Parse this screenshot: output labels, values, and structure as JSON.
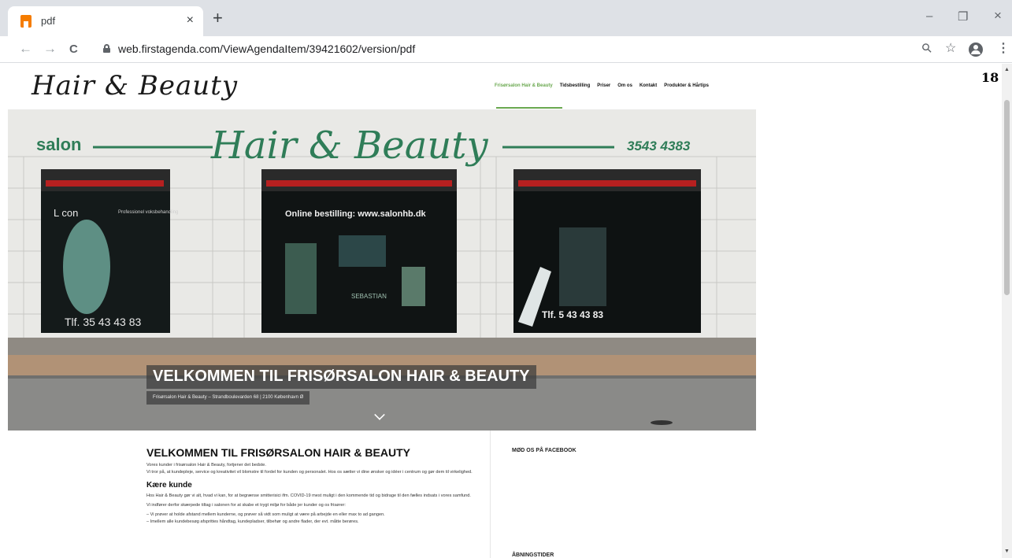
{
  "browser": {
    "tab_title": "pdf",
    "tab_close": "×",
    "new_tab": "+",
    "url": "web.firstagenda.com/ViewAgendaItem/39421602/version/pdf",
    "window_controls": {
      "minimize": "–",
      "restore": "❐",
      "close": "×"
    },
    "nav": {
      "back": "←",
      "forward": "→",
      "reload": "C"
    },
    "toolbar_icons": {
      "zoom": "⚲",
      "bookmark": "☆",
      "menu": "⋮"
    }
  },
  "viewer": {
    "page_number": "18"
  },
  "site": {
    "logo": "Hair & Beauty",
    "nav": [
      {
        "label": "Frisørsalon Hair & Beauty",
        "active": true
      },
      {
        "label": "Tidsbestilling",
        "active": false
      },
      {
        "label": "Priser",
        "active": false
      },
      {
        "label": "Om os",
        "active": false
      },
      {
        "label": "Kontakt",
        "active": false
      },
      {
        "label": "Produkter & Hårtips",
        "active": false
      }
    ],
    "hero": {
      "storefront_sign": "Hair & Beauty",
      "sign_left": "salon",
      "sign_phone": "3543 4383",
      "window_text": "Online bestilling: www.salonhb.dk",
      "window_left_brand": "L con",
      "window_left_sub": "Professionel voksbehandling",
      "phone_left": "Tlf. 35 43 43 83",
      "phone_right": "Tlf. 5 43 43 83",
      "brand_sebastian": "SEBASTIAN",
      "title": "VELKOMMEN TIL FRISØRSALON HAIR & BEAUTY",
      "subtitle": "Frisørsalon Hair & Beauty – Strandboulevarden 68 | 2100 København Ø"
    },
    "content": {
      "heading": "VELKOMMEN TIL FRISØRSALON HAIR & BEAUTY",
      "intro_1": "Vores kunder i frisørsalon Hair & Beauty, fortjener det bedste.",
      "intro_2": "Vi tror på, at kundepleje, service og kreativitet vil blomstre til fordel for kunden og personalet. Hos os sætter vi dine ønsker og idéer i centrum og gør dem til virkelighed.",
      "subheading": "Kære kunde",
      "para_1": "Hos Hair & Beauty gør vi alt, hvad vi kan, for at begrænse smitterisici ifm. COVID-19 mest muligt i den kommende tid og bidrage til den fælles indsats i vores samfund.",
      "para_2": "Vi indfører derfor skærpede tiltag i salonen for at skabe et trygt miljø for både jer kunder og os frisører:",
      "bullet_1": "– Vi prøver at holde afstand mellem kunderne, og prøver så vidt som muligt at være på arbejde en eller max to ad gangen.",
      "bullet_2": "– Imellem alle kundebesøg afsprittes håndtag, kundepladser, tilbehør og andre flader, der evt. måtte berøres."
    },
    "sidebar": {
      "facebook_heading": "MØD OS PÅ FACEBOOK",
      "opening_heading": "ÅBNINGSTIDER"
    }
  },
  "colors": {
    "accent_green": "#6aa84f",
    "tab_strip": "#dee1e6",
    "sign_green": "#2f7d58"
  }
}
